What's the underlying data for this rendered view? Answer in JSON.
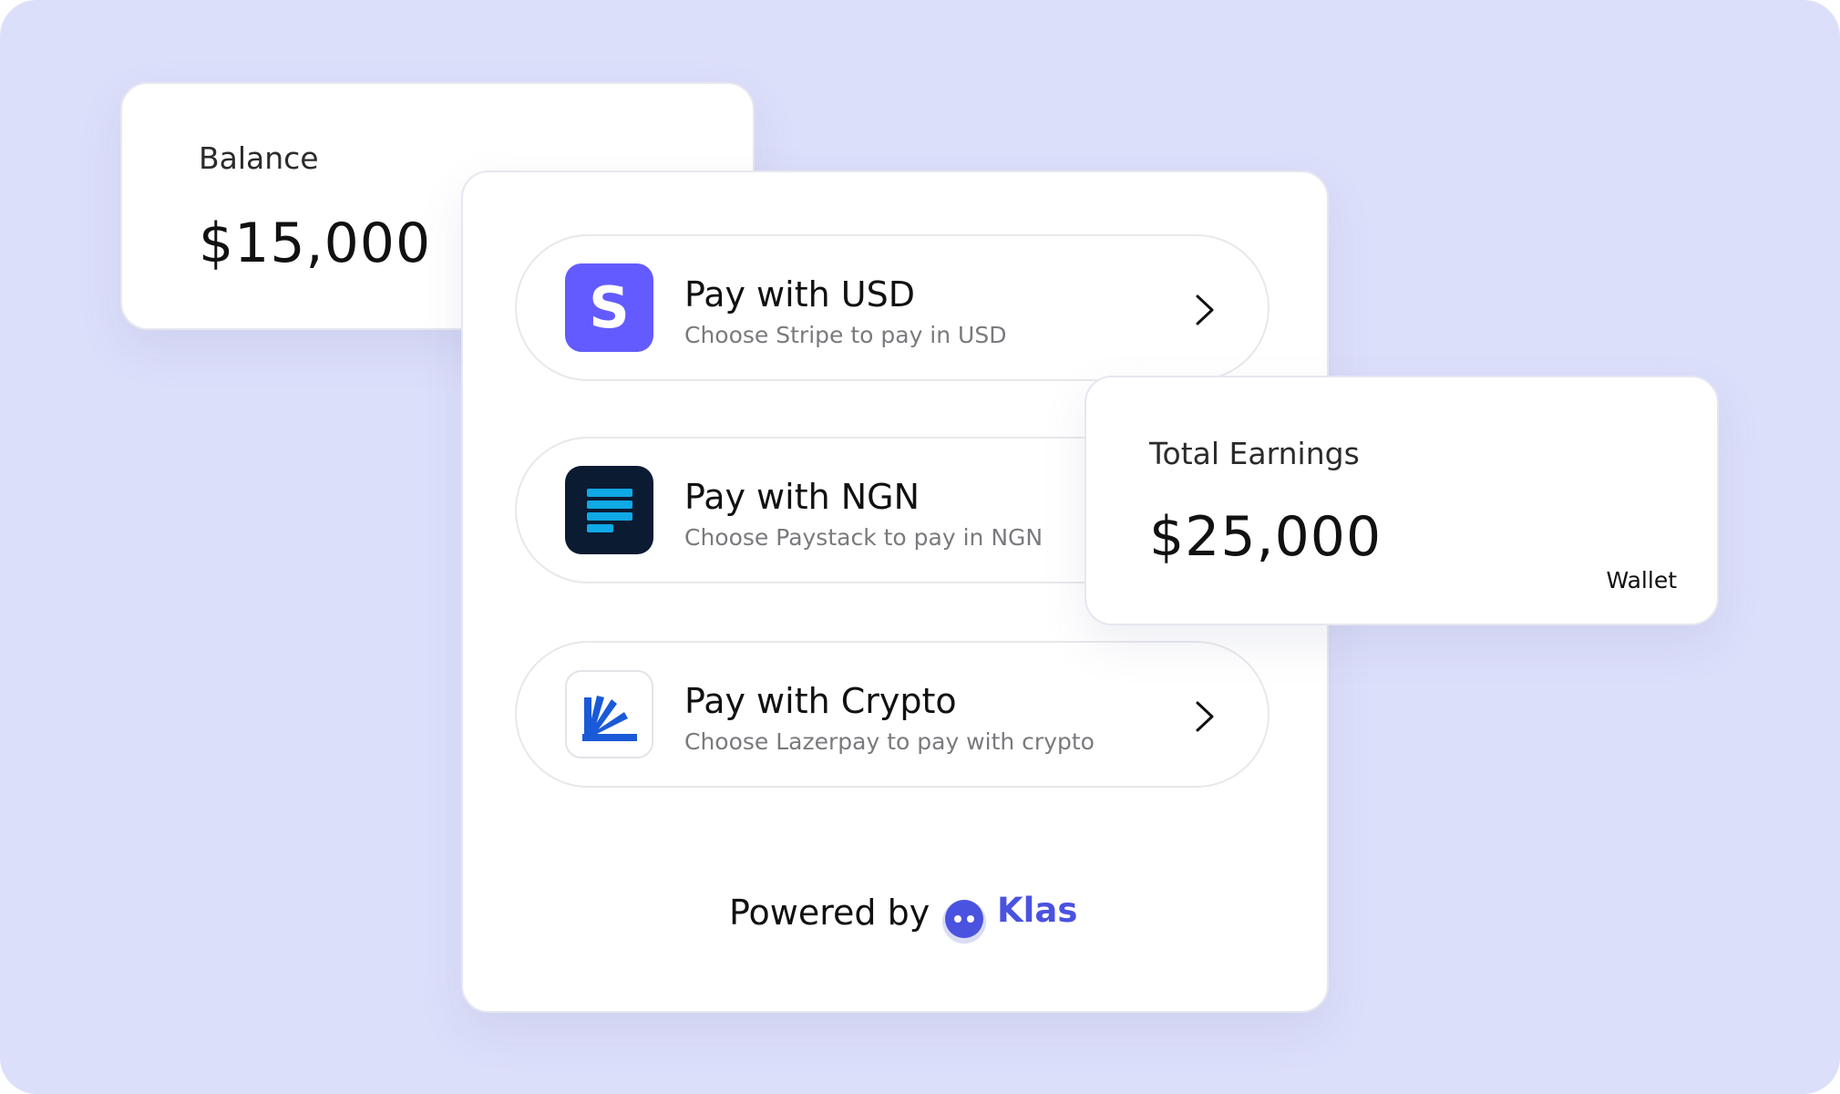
{
  "balance": {
    "label": "Balance",
    "amount": "$15,000"
  },
  "payment_options": [
    {
      "title": "Pay with USD",
      "subtitle": "Choose Stripe to pay in USD",
      "logo_icon": "stripe-logo-icon",
      "logo_letter": "S",
      "logo_color": "#635bff"
    },
    {
      "title": "Pay with NGN",
      "subtitle": "Choose Paystack to pay in NGN",
      "logo_icon": "paystack-logo-icon",
      "logo_color": "#0b1b32"
    },
    {
      "title": "Pay with Crypto",
      "subtitle": "Choose Lazerpay to pay with crypto",
      "logo_icon": "lazerpay-logo-icon",
      "logo_color": "#1a5ad8"
    }
  ],
  "footer": {
    "powered_by": "Powered by",
    "brand": "Klas",
    "brand_color": "#4a52e0"
  },
  "earnings": {
    "label": "Total Earnings",
    "amount": "$25,000",
    "tag": "Wallet"
  },
  "colors": {
    "background": "#dcdffa",
    "card": "#ffffff",
    "accent": "#635bff"
  }
}
